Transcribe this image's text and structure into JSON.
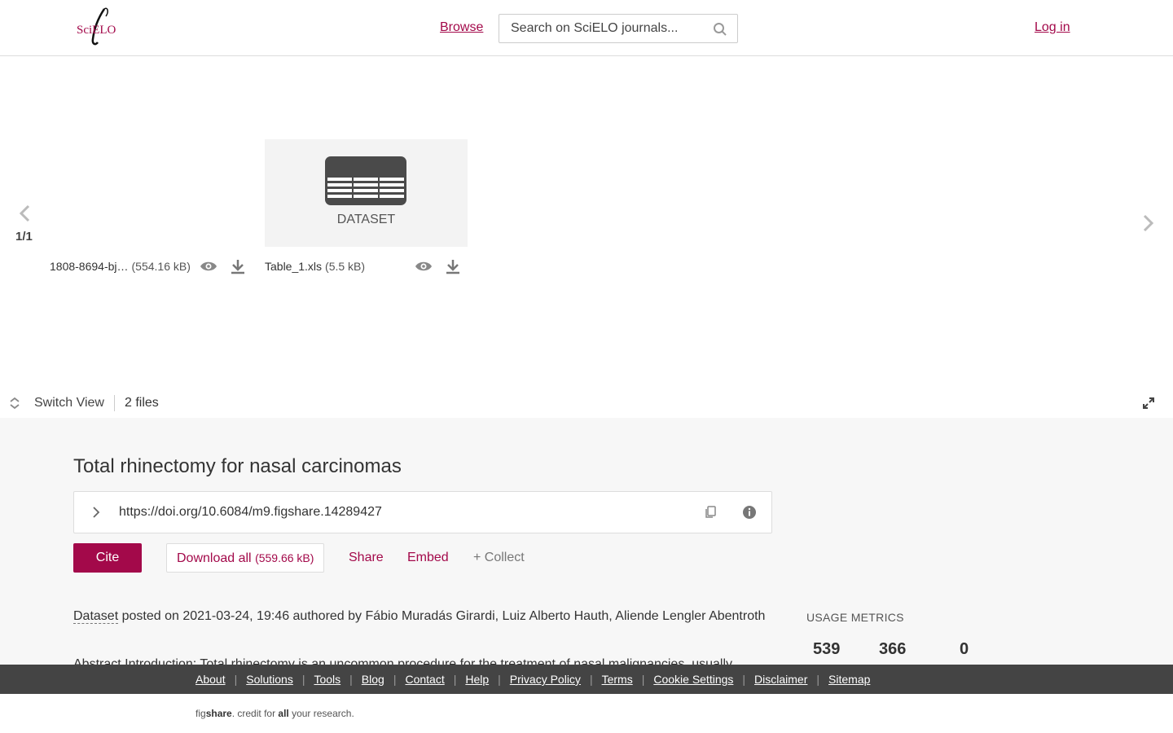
{
  "header": {
    "logo_text": "SciELO",
    "browse_label": "Browse",
    "search_placeholder": "Search on SciELO journals...",
    "login_label": "Log in"
  },
  "carousel": {
    "page_indicator": "1/1",
    "files": [
      {
        "name": "1808-8694-bj…",
        "size": "(554.16 kB)"
      },
      {
        "name": "Table_1.xls",
        "size": "(5.5 kB)",
        "thumb_label": "DATASET"
      }
    ]
  },
  "switch_bar": {
    "switch_label": "Switch View",
    "files_count": "2 files"
  },
  "item": {
    "title": "Total rhinectomy for nasal carcinomas",
    "doi": "https://doi.org/10.6084/m9.figshare.14289427",
    "cite_label": "Cite",
    "download_label": "Download all",
    "download_size": "(559.66 kB)",
    "share_label": "Share",
    "embed_label": "Embed",
    "collect_label": "+ Collect",
    "type": "Dataset",
    "meta_rest": " posted on 2021-03-24, 19:46 authored by Fábio Muradás Girardi, Luiz Alberto Hauth, Aliende Lengler Abentroth",
    "abstract": "Abstract Introduction: Total rhinectomy is an uncommon procedure for the treatment of nasal malignancies, usually"
  },
  "usage_metrics": {
    "title": "USAGE METRICS",
    "values": [
      "539",
      "366",
      "0"
    ]
  },
  "footer": {
    "links": [
      "About",
      "Solutions",
      "Tools",
      "Blog",
      "Contact",
      "Help",
      "Privacy Policy",
      "Terms",
      "Cookie Settings",
      "Disclaimer",
      "Sitemap"
    ],
    "brand_prefix": "fig",
    "brand_bold": "share",
    "tagline_1": ". credit for ",
    "tagline_bold": "all",
    "tagline_2": " your research."
  },
  "colors": {
    "accent": "#a3094a",
    "footer_bg": "#444444",
    "main_bg": "#f7f7f7"
  }
}
